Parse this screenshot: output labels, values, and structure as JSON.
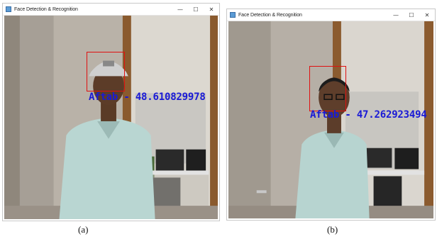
{
  "windows": [
    {
      "title": "Face Detection & Recognition",
      "controls": {
        "minimize": "—",
        "maximize": "☐",
        "close": "✕"
      },
      "recognition_label": "Aftab - 48.610829978"
    },
    {
      "title": "Face Detection & Recognition",
      "controls": {
        "minimize": "—",
        "maximize": "☐",
        "close": "✕"
      },
      "recognition_label": "Aftab - 47.262923494"
    }
  ],
  "captions": [
    "(a)",
    "(b)"
  ],
  "colors": {
    "face_box": "#e01010",
    "label_text": "#1a1ad6"
  }
}
